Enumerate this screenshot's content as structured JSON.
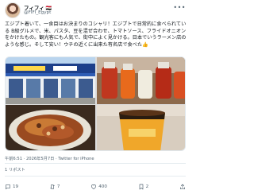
{
  "user": {
    "display_name": "フィフィ",
    "flag": "🇪🇬",
    "handle": "@FIFI_Egypt"
  },
  "tweet": {
    "text": "エジプト着いて、一食目はお決まりのコシャリ！エジプトで日常的に食べられている B級グルメで、米、パスタ、豆を混ぜ合わせ、トマトソース、フライドオニオンをかけたもの。観光客にも人気で、街中によく見かける。日本でいうラーメン店のような感じ。そして安い！ウチの近くに出来た有名店で食べた👍",
    "timestamp": "午前6:51 · 2026年5月7日 · ",
    "source": "Twitter for iPhone",
    "repost_label": "1 リポスト"
  },
  "photos": [
    {
      "alt": "koshary-shop-storefront"
    },
    {
      "alt": "sauce-bottles"
    },
    {
      "alt": "koshary-plate"
    },
    {
      "alt": "koshary-cup"
    }
  ],
  "actions": {
    "reply_count": "19",
    "retweet_count": "7",
    "like_count": "400",
    "bookmark_count": "2"
  }
}
